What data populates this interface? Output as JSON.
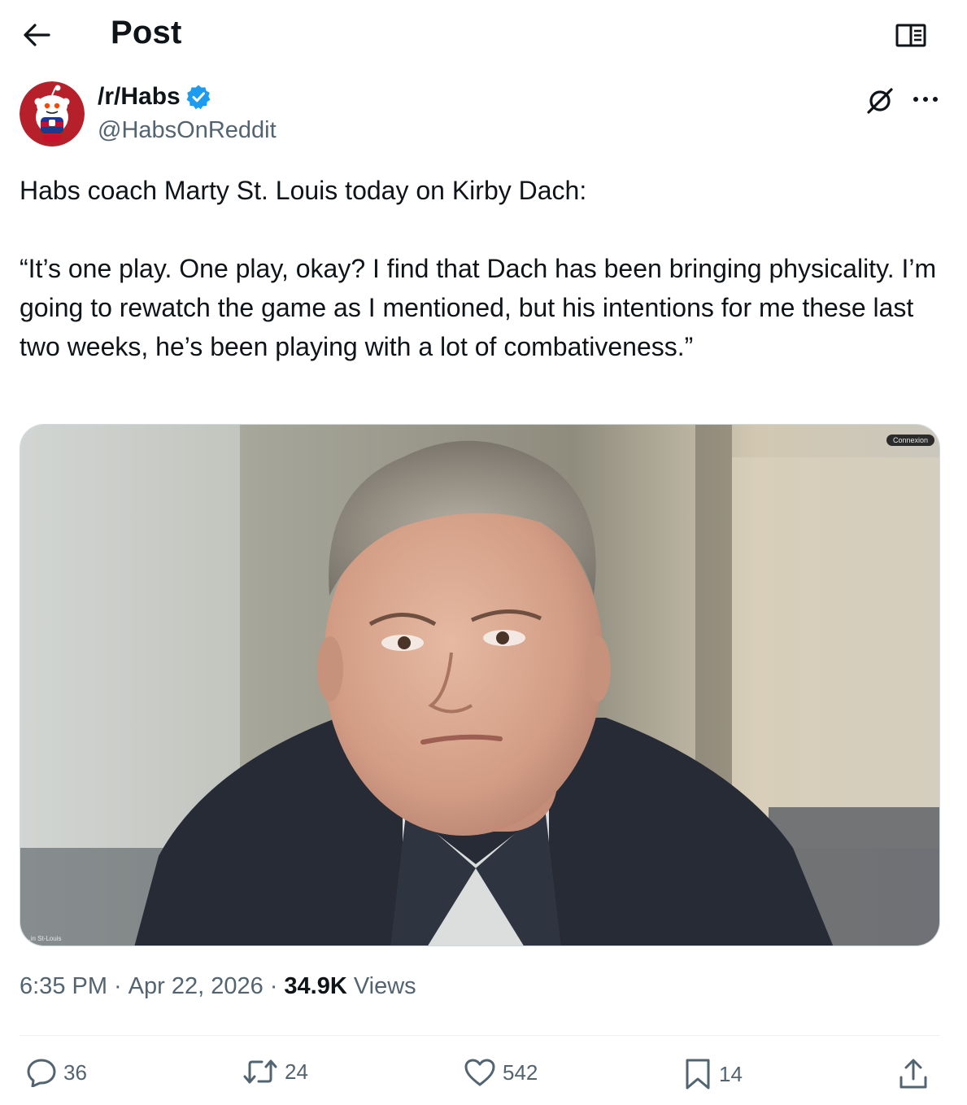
{
  "header": {
    "title": "Post"
  },
  "author": {
    "name": "/r/Habs",
    "handle": "@HabsOnReddit"
  },
  "post": {
    "line1": "Habs coach Marty St. Louis today on Kirby Dach:",
    "quote": "“It’s one play. One play, okay? I find that Dach has been bringing physicality. I’m going to rewatch the game as I mentioned, but his intentions for me these last two weeks, he’s been playing with a lot of combativeness.”"
  },
  "media": {
    "badge": "Connexion",
    "name_tag": "...in St-Louis"
  },
  "meta": {
    "time": "6:35 PM",
    "date": "Apr 22, 2026",
    "views_count": "34.9K",
    "views_label": "Views"
  },
  "actions": {
    "replies": "36",
    "reposts": "24",
    "likes": "542",
    "bookmarks": "14"
  },
  "colors": {
    "text": "#0f1419",
    "secondary": "#536471",
    "verified": "#1d9bf0",
    "avatar_bg": "#b5202a"
  }
}
